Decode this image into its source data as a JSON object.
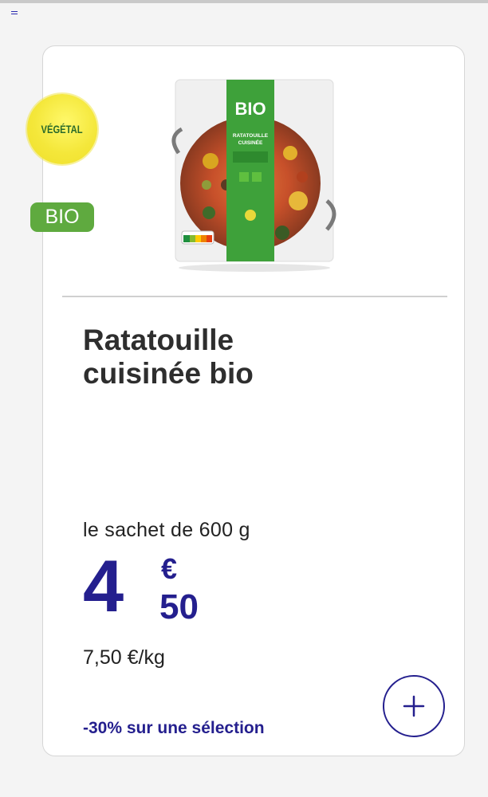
{
  "product": {
    "badges": {
      "vegetal": "VÉGÉTAL",
      "bio": "BIO"
    },
    "image": {
      "package_brand": "BIO",
      "package_name_line1": "RATATOUILLE",
      "package_name_line2": "CUISINÉE",
      "icon": "product-package-image"
    },
    "title_line1": "Ratatouille",
    "title_line2": "cuisinée bio",
    "unit": "le sachet de 600 g",
    "price": {
      "integer": "4",
      "currency": "€",
      "decimals": "50"
    },
    "price_per_kg": "7,50 €/kg",
    "promo": "-30% sur une sélection",
    "add_button_icon": "plus-icon"
  },
  "colors": {
    "brand_blue": "#241f8e",
    "bio_green": "#5faa3f",
    "vegetal_yellow": "#f4e73a"
  }
}
